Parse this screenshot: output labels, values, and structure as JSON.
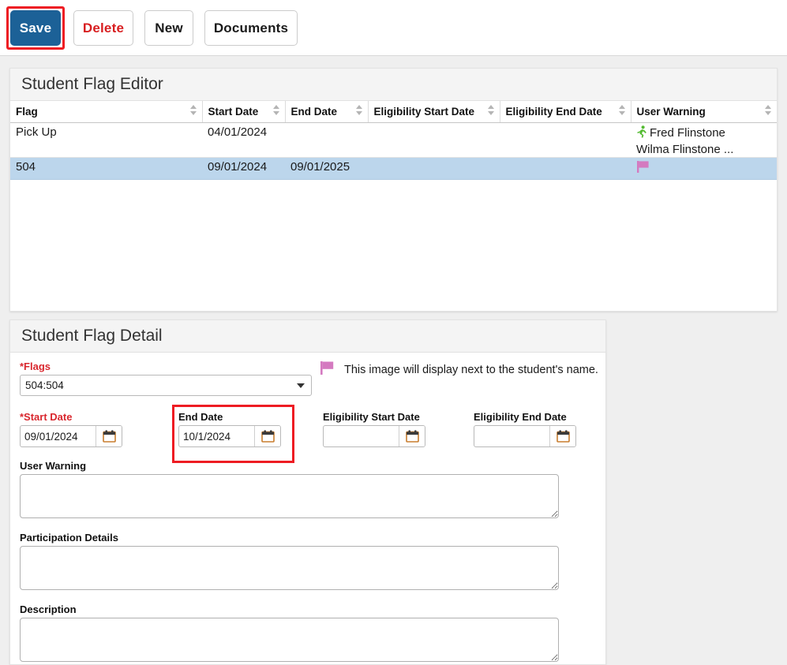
{
  "toolbar": {
    "save_label": "Save",
    "delete_label": "Delete",
    "new_label": "New",
    "documents_label": "Documents"
  },
  "editor": {
    "title": "Student Flag Editor",
    "columns": [
      "Flag",
      "Start Date",
      "End Date",
      "Eligibility Start Date",
      "Eligibility End Date",
      "User Warning"
    ],
    "rows": [
      {
        "flag": "Pick Up",
        "start_date": "04/01/2024",
        "end_date": "",
        "eligibility_start_date": "",
        "eligibility_end_date": "",
        "user_warning_icon": "running-person-icon",
        "user_warning_line1": "Fred Flinstone",
        "user_warning_line2": "Wilma Flinstone ...",
        "selected": false
      },
      {
        "flag": "504",
        "start_date": "09/01/2024",
        "end_date": "09/01/2025",
        "eligibility_start_date": "",
        "eligibility_end_date": "",
        "user_warning_icon": "flag-icon",
        "user_warning_line1": "",
        "user_warning_line2": "",
        "selected": true
      }
    ]
  },
  "detail": {
    "title": "Student Flag Detail",
    "flags_label": "*Flags",
    "flags_value": "504:504",
    "flag_note": "This image will display next to the student's name.",
    "start_date_label": "*Start Date",
    "start_date_value": "09/01/2024",
    "end_date_label": "End Date",
    "end_date_value": "10/1/2024",
    "elig_start_label": "Eligibility Start Date",
    "elig_start_value": "",
    "elig_end_label": "Eligibility End Date",
    "elig_end_value": "",
    "user_warning_label": "User Warning",
    "user_warning_value": "",
    "participation_label": "Participation Details",
    "participation_value": "",
    "description_label": "Description",
    "description_value": ""
  },
  "colors": {
    "save_button": "#1c6197",
    "delete_text": "#d81e20",
    "highlight_ring": "#ee1c23",
    "selected_row": "#bcd6ec",
    "flag_icon": "#d47ac0",
    "running_icon": "#55bb33",
    "required_label": "#d9272e"
  }
}
